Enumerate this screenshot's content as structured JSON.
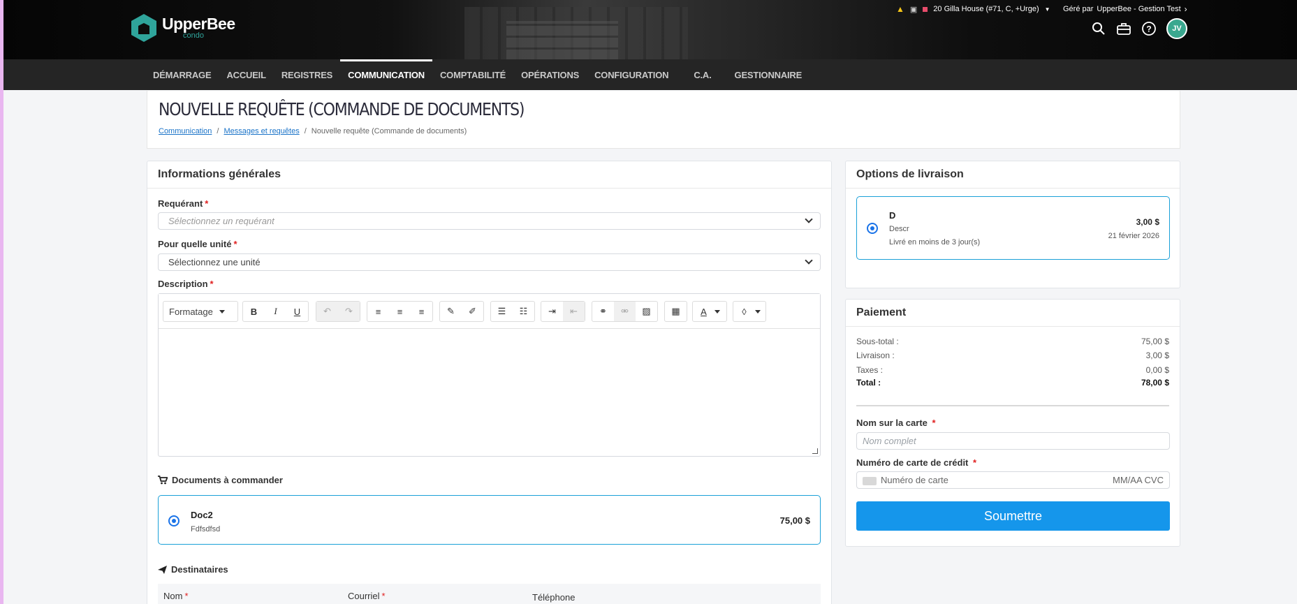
{
  "app": {
    "logo_name": "UpperBee",
    "logo_sub": "condo"
  },
  "topbar": {
    "property": "20 Gilla House (#71, C, +Urge)",
    "managed_prefix": "Géré par",
    "managed_by": "UpperBee - Gestion Test",
    "avatar_initials": "JV"
  },
  "nav": {
    "items": [
      {
        "label": "DÉMARRAGE"
      },
      {
        "label": "ACCUEIL"
      },
      {
        "label": "REGISTRES"
      },
      {
        "label": "COMMUNICATION",
        "active": true
      },
      {
        "label": "COMPTABILITÉ"
      },
      {
        "label": "OPÉRATIONS"
      },
      {
        "label": "CONFIGURATION"
      },
      {
        "label": "C.A."
      },
      {
        "label": "GESTIONNAIRE"
      }
    ]
  },
  "page": {
    "title": "NOUVELLE REQUÊTE (COMMANDE DE DOCUMENTS)",
    "breadcrumb": [
      "Communication",
      "Messages et requêtes",
      "Nouvelle requête (Commande de documents)"
    ]
  },
  "general": {
    "title": "Informations générales",
    "requester_label": "Requérant",
    "requester_placeholder": "Sélectionnez un requérant",
    "unit_label": "Pour quelle unité",
    "unit_value": "Sélectionnez une unité",
    "description_label": "Description",
    "format_label": "Formatage",
    "required_mark": "*"
  },
  "documents": {
    "title": "Documents à commander",
    "items": [
      {
        "name": "Doc2",
        "desc": "Fdfsdfsd",
        "price": "75,00 $"
      }
    ]
  },
  "recipients": {
    "title": "Destinataires",
    "columns": [
      "Nom",
      "Courriel",
      "Téléphone"
    ]
  },
  "delivery": {
    "title": "Options de livraison",
    "option": {
      "name": "D",
      "desc": "Descr",
      "eta": "Livré en moins de 3 jour(s)",
      "price": "3,00 $",
      "date": "21 février 2026"
    }
  },
  "payment": {
    "title": "Paiement",
    "rows": [
      {
        "label": "Sous-total :",
        "value": "75,00 $"
      },
      {
        "label": "Livraison :",
        "value": "3,00 $"
      },
      {
        "label": "Taxes :",
        "value": "0,00 $"
      },
      {
        "label": "Total :",
        "value": "78,00 $"
      }
    ],
    "name_label": "Nom sur la carte",
    "name_placeholder": "Nom complet",
    "card_label": "Numéro de carte de crédit",
    "card_placeholder": "Numéro de carte",
    "card_exp_cvc": "MM/AA CVC",
    "submit": "Soumettre"
  },
  "colors": {
    "accent": "#1596eb",
    "brand": "#2fa49b",
    "nav_bg": "#252525",
    "required": "#e02020"
  }
}
